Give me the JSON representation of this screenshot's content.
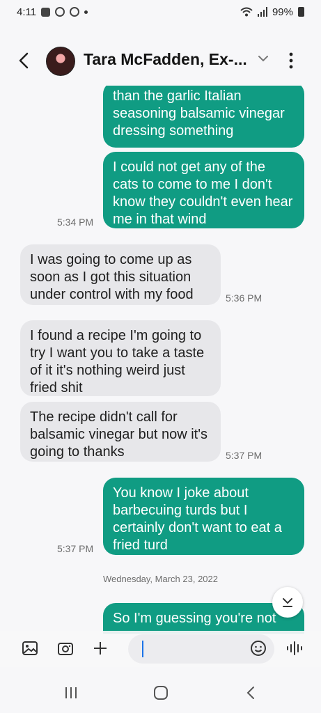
{
  "status_bar": {
    "time": "4:11",
    "battery": "99%"
  },
  "header": {
    "contact_name": "Tara McFadden, Ex-..."
  },
  "messages": [
    {
      "direction": "out",
      "text": "than the garlic Italian seasoning balsamic vinegar dressing something",
      "time": ""
    },
    {
      "direction": "out",
      "text": "I could not get any of the cats to come to me I don't know they couldn't even hear me in that wind",
      "time": "5:34 PM"
    },
    {
      "direction": "in",
      "text": "I was going to come up as soon as I got this situation under control with my food",
      "time": "5:36 PM"
    },
    {
      "direction": "in",
      "text": "I found a recipe I'm going to try I want you to take a taste of it it's nothing weird just fried shit",
      "time": ""
    },
    {
      "direction": "in",
      "text": "The recipe didn't call for balsamic vinegar but now it's going to thanks",
      "time": "5:37 PM"
    },
    {
      "direction": "out",
      "text": "You know I joke about barbecuing turds but I certainly don't want to eat a fried turd",
      "time": "5:37 PM"
    },
    {
      "direction": "out",
      "text": "So I'm guessing you're not",
      "time": ""
    }
  ],
  "date_separator": "Wednesday, March 23, 2022",
  "colors": {
    "outgoing_bubble": "#109c83",
    "incoming_bubble": "#e7e7ea",
    "background": "#f7f7f9"
  },
  "icons": {
    "back": "back-arrow-icon",
    "dropdown": "chevron-down-icon",
    "more": "more-vertical-icon",
    "gallery": "gallery-icon",
    "camera": "camera-icon",
    "add": "plus-icon",
    "emoji": "emoji-icon",
    "voice": "voice-wave-icon",
    "scroll": "scroll-down-icon"
  }
}
